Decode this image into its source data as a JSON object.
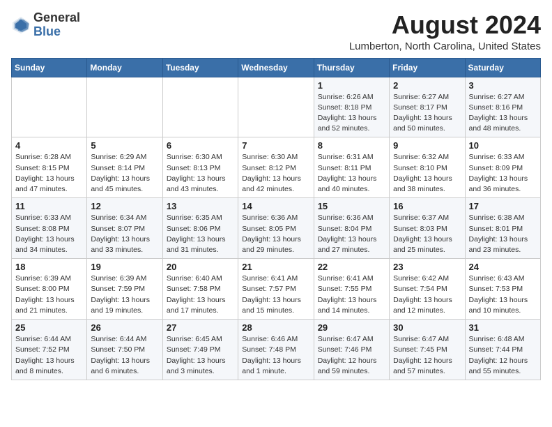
{
  "logo": {
    "general": "General",
    "blue": "Blue"
  },
  "header": {
    "month_year": "August 2024",
    "location": "Lumberton, North Carolina, United States"
  },
  "days_of_week": [
    "Sunday",
    "Monday",
    "Tuesday",
    "Wednesday",
    "Thursday",
    "Friday",
    "Saturday"
  ],
  "weeks": [
    [
      {
        "day": "",
        "info": ""
      },
      {
        "day": "",
        "info": ""
      },
      {
        "day": "",
        "info": ""
      },
      {
        "day": "",
        "info": ""
      },
      {
        "day": "1",
        "info": "Sunrise: 6:26 AM\nSunset: 8:18 PM\nDaylight: 13 hours\nand 52 minutes."
      },
      {
        "day": "2",
        "info": "Sunrise: 6:27 AM\nSunset: 8:17 PM\nDaylight: 13 hours\nand 50 minutes."
      },
      {
        "day": "3",
        "info": "Sunrise: 6:27 AM\nSunset: 8:16 PM\nDaylight: 13 hours\nand 48 minutes."
      }
    ],
    [
      {
        "day": "4",
        "info": "Sunrise: 6:28 AM\nSunset: 8:15 PM\nDaylight: 13 hours\nand 47 minutes."
      },
      {
        "day": "5",
        "info": "Sunrise: 6:29 AM\nSunset: 8:14 PM\nDaylight: 13 hours\nand 45 minutes."
      },
      {
        "day": "6",
        "info": "Sunrise: 6:30 AM\nSunset: 8:13 PM\nDaylight: 13 hours\nand 43 minutes."
      },
      {
        "day": "7",
        "info": "Sunrise: 6:30 AM\nSunset: 8:12 PM\nDaylight: 13 hours\nand 42 minutes."
      },
      {
        "day": "8",
        "info": "Sunrise: 6:31 AM\nSunset: 8:11 PM\nDaylight: 13 hours\nand 40 minutes."
      },
      {
        "day": "9",
        "info": "Sunrise: 6:32 AM\nSunset: 8:10 PM\nDaylight: 13 hours\nand 38 minutes."
      },
      {
        "day": "10",
        "info": "Sunrise: 6:33 AM\nSunset: 8:09 PM\nDaylight: 13 hours\nand 36 minutes."
      }
    ],
    [
      {
        "day": "11",
        "info": "Sunrise: 6:33 AM\nSunset: 8:08 PM\nDaylight: 13 hours\nand 34 minutes."
      },
      {
        "day": "12",
        "info": "Sunrise: 6:34 AM\nSunset: 8:07 PM\nDaylight: 13 hours\nand 33 minutes."
      },
      {
        "day": "13",
        "info": "Sunrise: 6:35 AM\nSunset: 8:06 PM\nDaylight: 13 hours\nand 31 minutes."
      },
      {
        "day": "14",
        "info": "Sunrise: 6:36 AM\nSunset: 8:05 PM\nDaylight: 13 hours\nand 29 minutes."
      },
      {
        "day": "15",
        "info": "Sunrise: 6:36 AM\nSunset: 8:04 PM\nDaylight: 13 hours\nand 27 minutes."
      },
      {
        "day": "16",
        "info": "Sunrise: 6:37 AM\nSunset: 8:03 PM\nDaylight: 13 hours\nand 25 minutes."
      },
      {
        "day": "17",
        "info": "Sunrise: 6:38 AM\nSunset: 8:01 PM\nDaylight: 13 hours\nand 23 minutes."
      }
    ],
    [
      {
        "day": "18",
        "info": "Sunrise: 6:39 AM\nSunset: 8:00 PM\nDaylight: 13 hours\nand 21 minutes."
      },
      {
        "day": "19",
        "info": "Sunrise: 6:39 AM\nSunset: 7:59 PM\nDaylight: 13 hours\nand 19 minutes."
      },
      {
        "day": "20",
        "info": "Sunrise: 6:40 AM\nSunset: 7:58 PM\nDaylight: 13 hours\nand 17 minutes."
      },
      {
        "day": "21",
        "info": "Sunrise: 6:41 AM\nSunset: 7:57 PM\nDaylight: 13 hours\nand 15 minutes."
      },
      {
        "day": "22",
        "info": "Sunrise: 6:41 AM\nSunset: 7:55 PM\nDaylight: 13 hours\nand 14 minutes."
      },
      {
        "day": "23",
        "info": "Sunrise: 6:42 AM\nSunset: 7:54 PM\nDaylight: 13 hours\nand 12 minutes."
      },
      {
        "day": "24",
        "info": "Sunrise: 6:43 AM\nSunset: 7:53 PM\nDaylight: 13 hours\nand 10 minutes."
      }
    ],
    [
      {
        "day": "25",
        "info": "Sunrise: 6:44 AM\nSunset: 7:52 PM\nDaylight: 13 hours\nand 8 minutes."
      },
      {
        "day": "26",
        "info": "Sunrise: 6:44 AM\nSunset: 7:50 PM\nDaylight: 13 hours\nand 6 minutes."
      },
      {
        "day": "27",
        "info": "Sunrise: 6:45 AM\nSunset: 7:49 PM\nDaylight: 13 hours\nand 3 minutes."
      },
      {
        "day": "28",
        "info": "Sunrise: 6:46 AM\nSunset: 7:48 PM\nDaylight: 13 hours\nand 1 minute."
      },
      {
        "day": "29",
        "info": "Sunrise: 6:47 AM\nSunset: 7:46 PM\nDaylight: 12 hours\nand 59 minutes."
      },
      {
        "day": "30",
        "info": "Sunrise: 6:47 AM\nSunset: 7:45 PM\nDaylight: 12 hours\nand 57 minutes."
      },
      {
        "day": "31",
        "info": "Sunrise: 6:48 AM\nSunset: 7:44 PM\nDaylight: 12 hours\nand 55 minutes."
      }
    ]
  ]
}
